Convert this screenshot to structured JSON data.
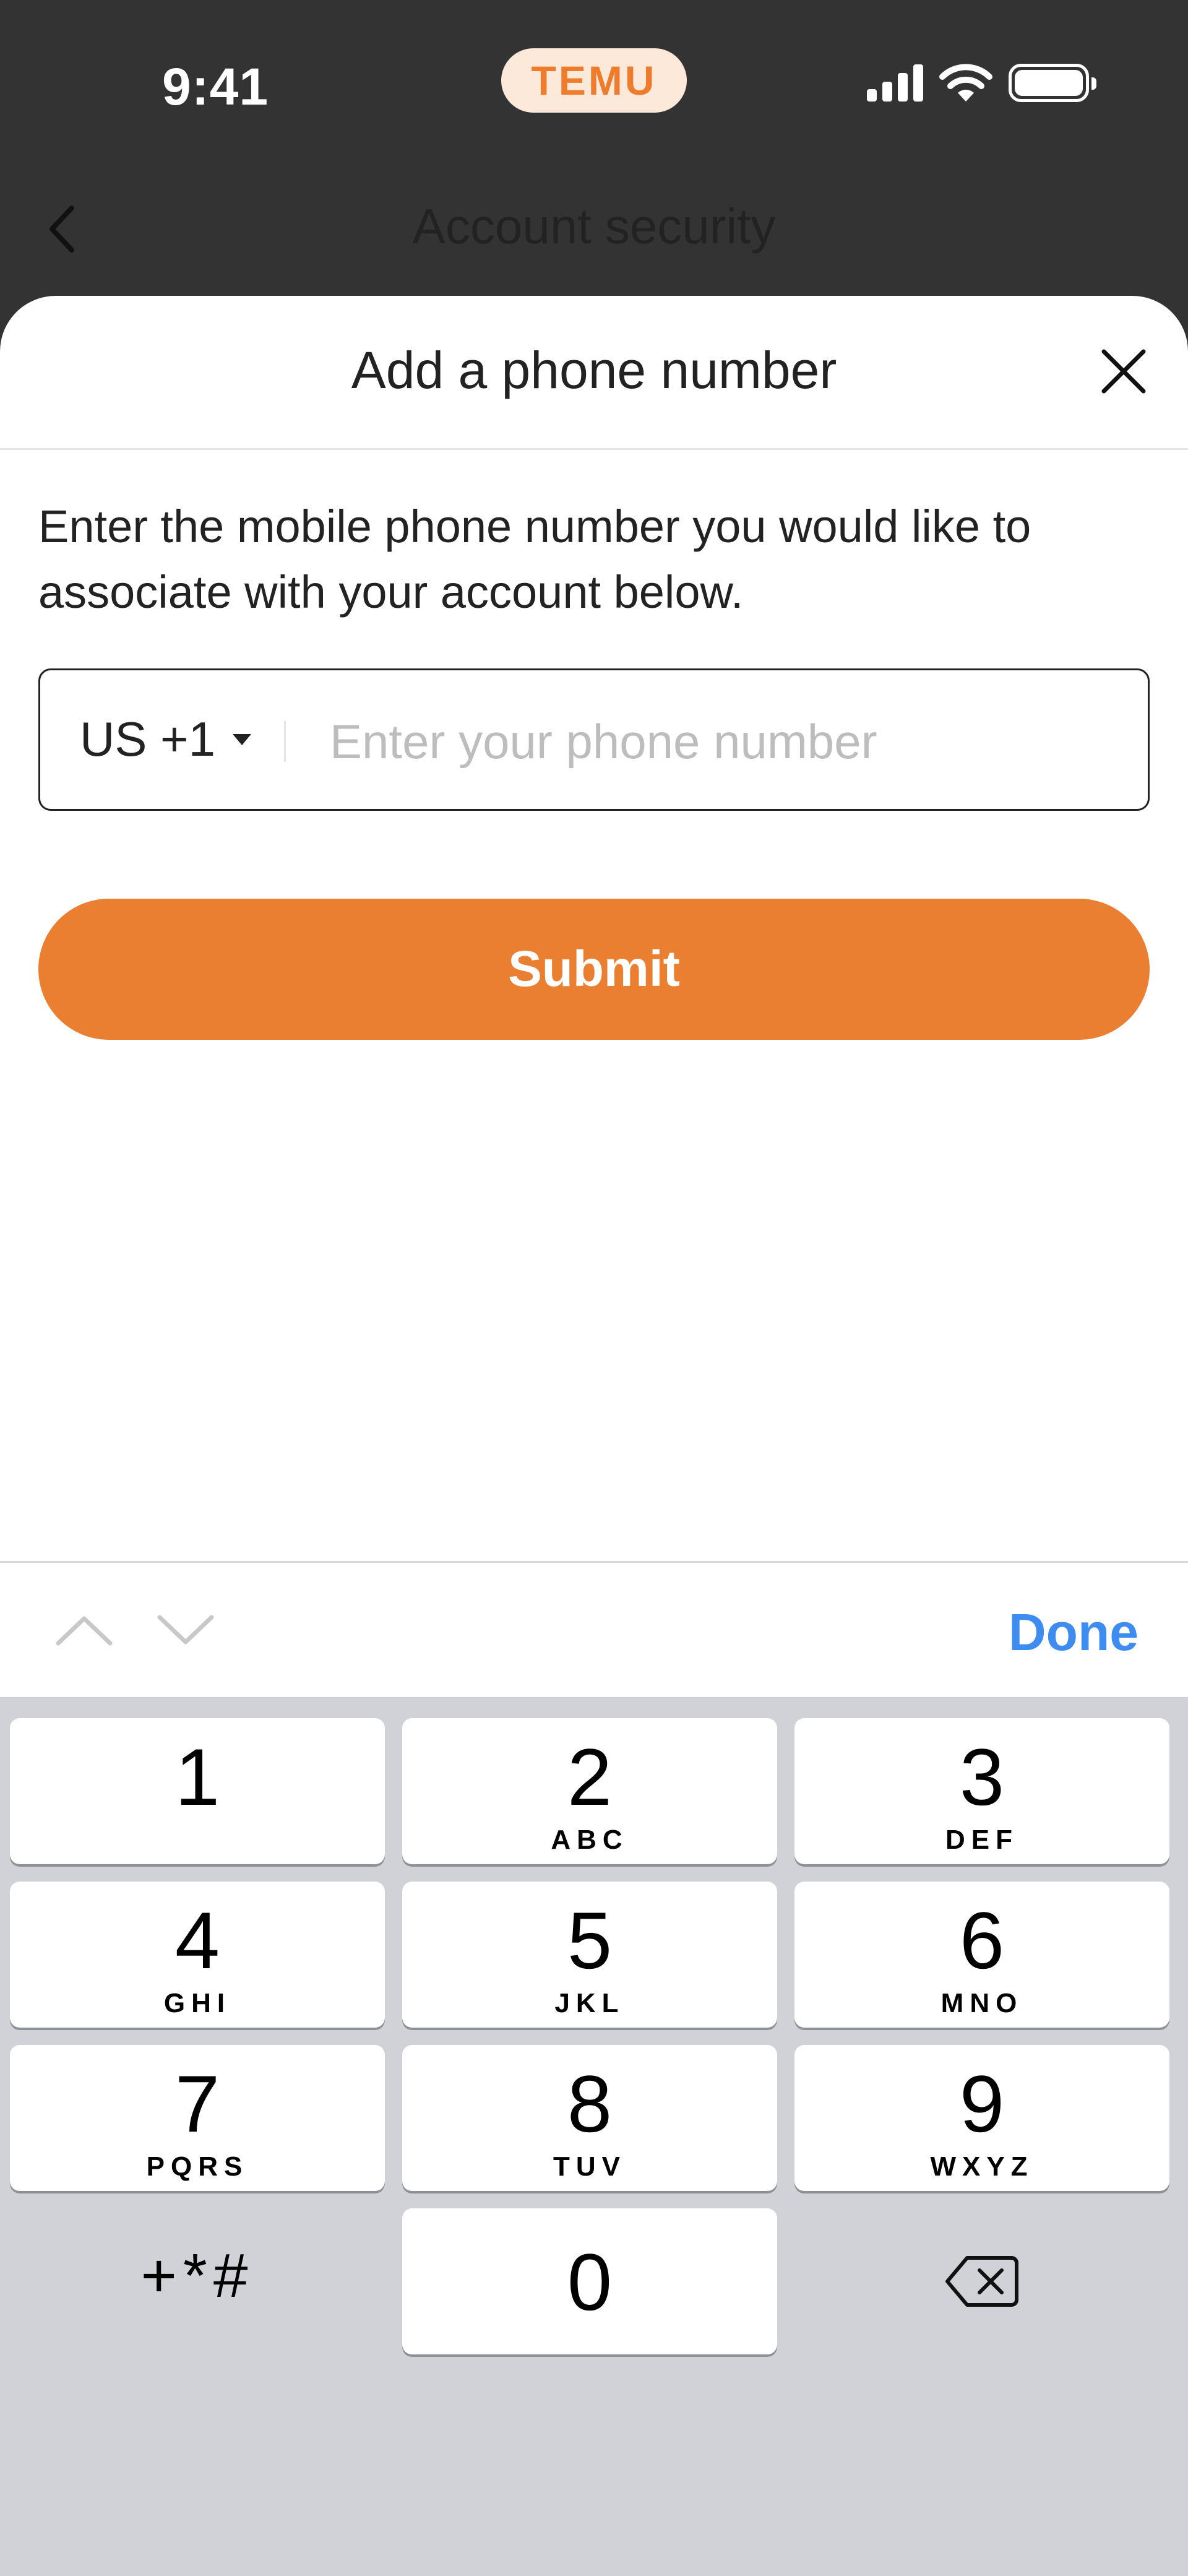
{
  "status_bar": {
    "time": "9:41",
    "brand": "TEMU"
  },
  "nav": {
    "title": "Account security"
  },
  "sheet": {
    "title": "Add a phone number",
    "description": "Enter the mobile phone number you would like to associate with your account below.",
    "country_code": "US +1",
    "phone_value": "",
    "phone_placeholder": "Enter your phone number",
    "submit_label": "Submit"
  },
  "accessory": {
    "done_label": "Done"
  },
  "keyboard": {
    "keys": [
      {
        "digit": "1",
        "letters": ""
      },
      {
        "digit": "2",
        "letters": "ABC"
      },
      {
        "digit": "3",
        "letters": "DEF"
      },
      {
        "digit": "4",
        "letters": "GHI"
      },
      {
        "digit": "5",
        "letters": "JKL"
      },
      {
        "digit": "6",
        "letters": "MNO"
      },
      {
        "digit": "7",
        "letters": "PQRS"
      },
      {
        "digit": "8",
        "letters": "TUV"
      },
      {
        "digit": "9",
        "letters": "WXYZ"
      },
      {
        "digit": "0",
        "letters": ""
      }
    ],
    "symbols": "+*#"
  },
  "colors": {
    "status_background": "#333333",
    "accent": "#EA7F32",
    "brand_text": "#EE7C2C",
    "brand_pill": "#FCE9DA",
    "done_blue": "#3F8CF0",
    "keyboard_background": "#D1D2D7"
  },
  "icons": {
    "back": "chevron-left-icon",
    "close": "close-icon",
    "prev_field": "chevron-up-icon",
    "next_field": "chevron-down-icon",
    "dropdown": "caret-down-icon",
    "delete": "backspace-icon",
    "signal": "cellular-signal-icon",
    "wifi": "wifi-icon",
    "battery": "battery-icon"
  }
}
